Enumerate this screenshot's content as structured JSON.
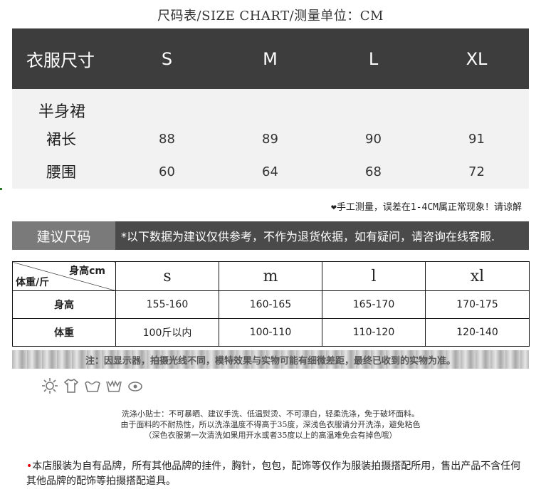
{
  "title": "尺码表/SIZE CHART/测量单位：CM",
  "chart1": {
    "header_label": "衣服尺寸",
    "sizes": [
      "S",
      "M",
      "L",
      "XL"
    ],
    "section": "半身裙",
    "rows": [
      {
        "label": "裙长",
        "values": [
          "88",
          "89",
          "90",
          "91"
        ]
      },
      {
        "label": "腰围",
        "values": [
          "60",
          "64",
          "68",
          "72"
        ]
      }
    ]
  },
  "measure_note": {
    "heart": "❤",
    "text": "手工测量，误差在1-4CM属正常现象！请谅解"
  },
  "suggestion": {
    "label": "建议尺码",
    "text": "*以下数据为建议仅供参考，不作为退货依据，如有疑问，请咨询在线客服."
  },
  "chart2": {
    "corner_top": "身高cm",
    "corner_bottom": "体重/斤",
    "sizes": [
      "s",
      "m",
      "l",
      "xl"
    ],
    "rows": [
      {
        "label": "身高",
        "values": [
          "155-160",
          "160-165",
          "165-170",
          "170-175"
        ]
      },
      {
        "label": "体重",
        "values": [
          "100斤以内",
          "100-110",
          "110-120",
          "120-140"
        ]
      }
    ]
  },
  "strip_note": "注：因显示器，拍摄光线不同，模特效果与实物可能有细微差距，最终已收到的实物为准。",
  "care_icons": [
    "sun-dry-icon",
    "iron-shirt-icon",
    "hand-wash-icon",
    "wash-basin-icon",
    "no-bleach-icon"
  ],
  "wash_tips": [
    "洗涤小贴士：不可暴晒、建议手洗、低温熨烫、不可漂白，轻柔洗涤，免于破坏面料。",
    "由于面料的不耐热性，所以洗涤温度不得高于35度，深浅色衣服请分开洗涤，避免粘色",
    "（深色衣服第一次清洗如果用开水或者35度以上的高温难免会有掉色哦）"
  ],
  "store_note": {
    "bullet": "•",
    "text": "本店服装为自有品牌，所有其他品牌的挂件，胸针，包包，配饰等仅作为服装拍摄搭配所用，售出产品不含任何其他品牌的配饰等拍摄搭配道具。"
  }
}
